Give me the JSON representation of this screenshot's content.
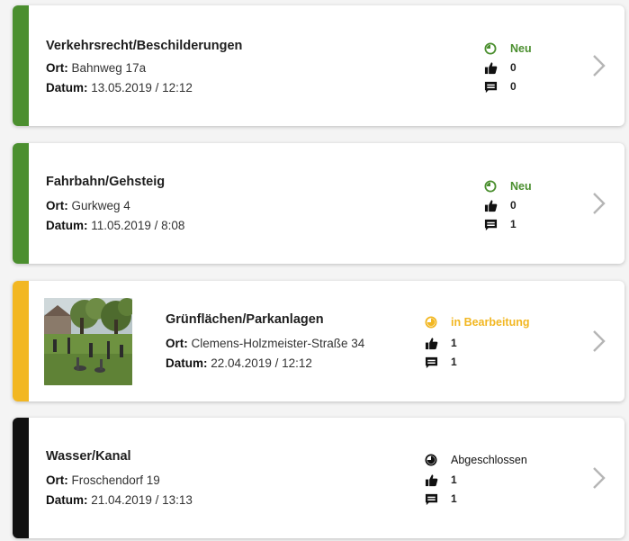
{
  "labels": {
    "location": "Ort:",
    "date": "Datum:"
  },
  "colors": {
    "green": "#4b8f2f",
    "yellow": "#f2b722",
    "black": "#111111"
  },
  "items": [
    {
      "title": "Verkehrsrecht/Beschilderungen",
      "location": "Bahnweg 17a",
      "date": "13.05.2019 / 12:12",
      "status": "Neu",
      "status_color": "#4b8f2f",
      "likes": "0",
      "comments": "0",
      "has_image": false
    },
    {
      "title": "Fahrbahn/Gehsteig",
      "location": "Gurkweg 4",
      "date": "11.05.2019 / 8:08",
      "status": "Neu",
      "status_color": "#4b8f2f",
      "likes": "0",
      "comments": "1",
      "has_image": false
    },
    {
      "title": "Grünflächen/Parkanlagen",
      "location": "Clemens-Holzmeister-Straße 34",
      "date": "22.04.2019 / 12:12",
      "status": "in Bearbeitung",
      "status_color": "#f2b722",
      "likes": "1",
      "comments": "1",
      "has_image": true
    },
    {
      "title": "Wasser/Kanal",
      "location": "Froschendorf 19",
      "date": "21.04.2019 / 13:13",
      "status": "Abgeschlossen",
      "status_color": "#111111",
      "likes": "1",
      "comments": "1",
      "has_image": false
    }
  ]
}
